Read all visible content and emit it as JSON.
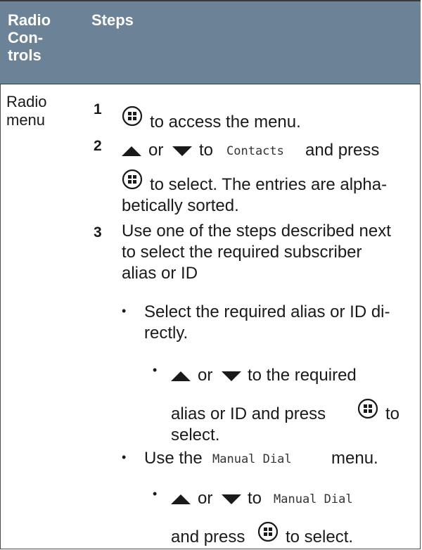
{
  "table": {
    "headers": [
      "Radio Con-trols",
      "Steps"
    ],
    "header_lines": [
      "Radio",
      "Con-",
      "trols"
    ],
    "steps_header": "Steps",
    "control": [
      "Radio",
      "menu"
    ]
  },
  "steps": [
    {
      "num": "1",
      "lines": [
        "to access the menu."
      ]
    },
    {
      "num": "2",
      "l1a": "or",
      "l1b": "to",
      "l1mono": "Contacts",
      "l1c": "and press",
      "l2": "to select. The entries are alpha-",
      "l3": "betically sorted."
    },
    {
      "num": "3",
      "lines": [
        "Use one of the steps described next",
        "to select the required subscriber",
        "alias or ID"
      ]
    }
  ],
  "options": [
    {
      "bullet": "•",
      "lines": [
        "Select the required alias or ID di-",
        "rectly."
      ],
      "sub": {
        "bullet": "•",
        "a": "or",
        "b": "to the required",
        "c": "alias or ID and press",
        "d": "to",
        "e": "select."
      }
    },
    {
      "bullet": "•",
      "pre": "Use the",
      "mono": "Manual Dial",
      "post": "menu.",
      "sub": {
        "bullet": "•",
        "a": "or",
        "b": "to",
        "mono": "Manual Dial",
        "c": "and press",
        "d": "to select."
      }
    }
  ],
  "icons": [
    "menu-ok-button-icon",
    "arrow-up-icon",
    "arrow-down-icon"
  ]
}
